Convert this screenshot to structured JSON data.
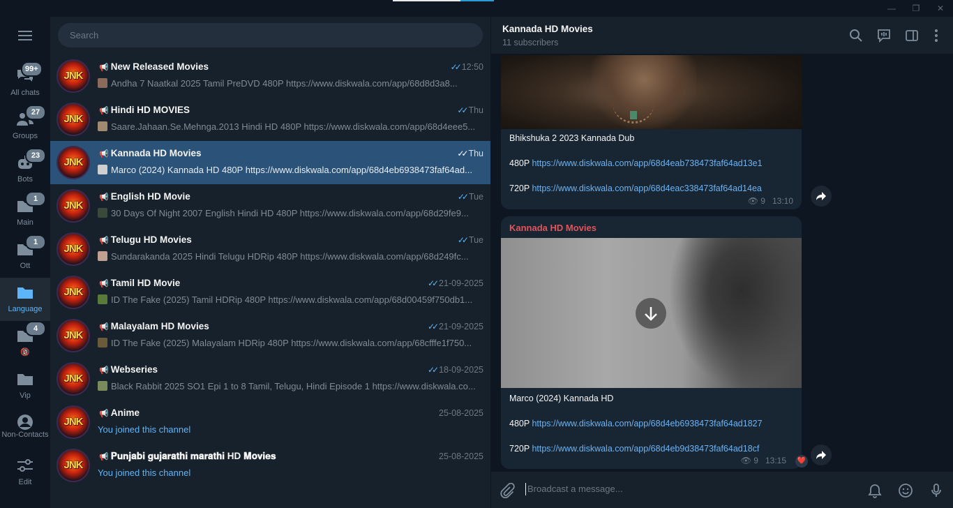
{
  "search": {
    "placeholder": "Search"
  },
  "folders": [
    {
      "label": "All chats",
      "badge": "99+",
      "icon": "chats-icon"
    },
    {
      "label": "Groups",
      "badge": "27",
      "icon": "groups-icon"
    },
    {
      "label": "Bots",
      "badge": "23",
      "icon": "bots-icon"
    },
    {
      "label": "Main",
      "badge": "1",
      "icon": "folder-icon"
    },
    {
      "label": "Ott",
      "badge": "1",
      "icon": "folder-icon"
    },
    {
      "label": "Language",
      "badge": "",
      "icon": "folder-icon",
      "active": true
    },
    {
      "label": "🔞",
      "badge": "4",
      "icon": "folder-icon"
    },
    {
      "label": "Vip",
      "badge": "",
      "icon": "folder-icon"
    },
    {
      "label": "Non-Contacts",
      "badge": "",
      "icon": "person-icon"
    },
    {
      "label": "Edit",
      "badge": "",
      "icon": "edit-icon"
    }
  ],
  "avatar_text": "JNK",
  "chats": [
    {
      "name": "New Released Movies",
      "time": "12:50",
      "ticks": true,
      "preview": "Andha 7 Naatkal 2025  Tamil PreDVD  480P https://www.diskwala.com/app/68d8d3a8..."
    },
    {
      "name": "Hindi HD MOVIES",
      "time": "Thu",
      "ticks": true,
      "preview": "Saare.Jahaan.Se.Mehnga.2013 Hindi HD  480P https://www.diskwala.com/app/68d4eee5..."
    },
    {
      "name": "Kannada HD Movies",
      "time": "Thu",
      "ticks": true,
      "preview": "Marco (2024) Kannada HD  480P https://www.diskwala.com/app/68d4eb6938473faf64ad...",
      "selected": true
    },
    {
      "name": "English HD Movie",
      "time": "Tue",
      "ticks": true,
      "preview": "30 Days Of Night 2007 English Hindi HD  480P https://www.diskwala.com/app/68d29fe9..."
    },
    {
      "name": "Telugu HD Movies",
      "time": "Tue",
      "ticks": true,
      "preview": "Sundarakanda 2025 Hindi Telugu HDRip  480P https://www.diskwala.com/app/68d249fc..."
    },
    {
      "name": "Tamil HD Movie",
      "time": "21-09-2025",
      "ticks": true,
      "preview": "ID The Fake (2025) Tamil HDRip  480P https://www.diskwala.com/app/68d00459f750db1..."
    },
    {
      "name": "Malayalam HD Movies",
      "time": "21-09-2025",
      "ticks": true,
      "preview": "ID The Fake (2025) Malayalam HDRip  480P https://www.diskwala.com/app/68cfffe1f750..."
    },
    {
      "name": "Webseries",
      "time": "18-09-2025",
      "ticks": true,
      "preview": "Black Rabbit 2025 SO1 Epi 1 to 8 Tamil, Telugu, Hindi  Episode 1 https://www.diskwala.co..."
    },
    {
      "name": "Anime",
      "time": "25-08-2025",
      "ticks": false,
      "preview": "You joined this channel",
      "joined": true
    },
    {
      "name": "𝐏𝐮𝐧𝐣𝐚𝐛𝐢 𝐠𝐮𝐣𝐚𝐫𝐚𝐭𝐡𝐢 𝐦𝐚𝐫𝐚𝐭𝐡𝐢 HD 𝐌𝐨𝐯𝐢𝐞𝐬",
      "time": "25-08-2025",
      "ticks": false,
      "preview": "You joined this channel",
      "joined": true
    }
  ],
  "header": {
    "title": "Kannada HD Movies",
    "subtitle": "11 subscribers"
  },
  "messages": [
    {
      "caption": "Bhikshuka 2 2023 Kannada Dub",
      "l480_label": "480P",
      "l480": "https://www.diskwala.com/app/68d4eab738473faf64ad13e1",
      "l720_label": "720P",
      "l720": "https://www.diskwala.com/app/68d4eac338473faf64ad14ea",
      "views": "9",
      "time": "13:10"
    },
    {
      "sender": "Kannada HD Movies",
      "caption": "Marco (2024) Kannada HD",
      "l480_label": "480P",
      "l480": "https://www.diskwala.com/app/68d4eb6938473faf64ad1827",
      "l720_label": "720P",
      "l720": "https://www.diskwala.com/app/68d4eb9d38473faf64ad18cf",
      "views": "9",
      "time": "13:15",
      "reaction": "❤️"
    }
  ],
  "composer": {
    "placeholder": "Broadcast a message..."
  }
}
